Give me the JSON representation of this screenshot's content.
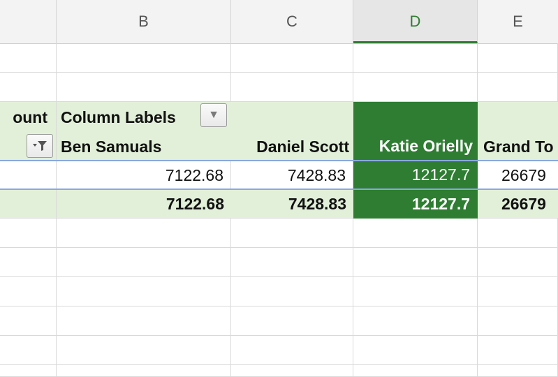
{
  "columns": [
    "B",
    "C",
    "D",
    "E"
  ],
  "selected_column": "D",
  "pivot": {
    "header_row1_a": "ount",
    "column_labels_title": "Column Labels",
    "names": [
      "Ben Samuals",
      "Daniel Scott",
      "Katie Orielly",
      "Grand To"
    ],
    "values_row": [
      "7122.68",
      "7428.83",
      "12127.7",
      "26679"
    ],
    "total_row": [
      "7122.68",
      "7428.83",
      "12127.7",
      "26679"
    ]
  },
  "colors": {
    "pivot_fill": "#e2f0d9",
    "selected_fill": "#2e7d32",
    "row_border": "#8aa8e0"
  },
  "icons": {
    "dropdown": "dropdown-arrow-icon",
    "filter": "filter-icon"
  }
}
